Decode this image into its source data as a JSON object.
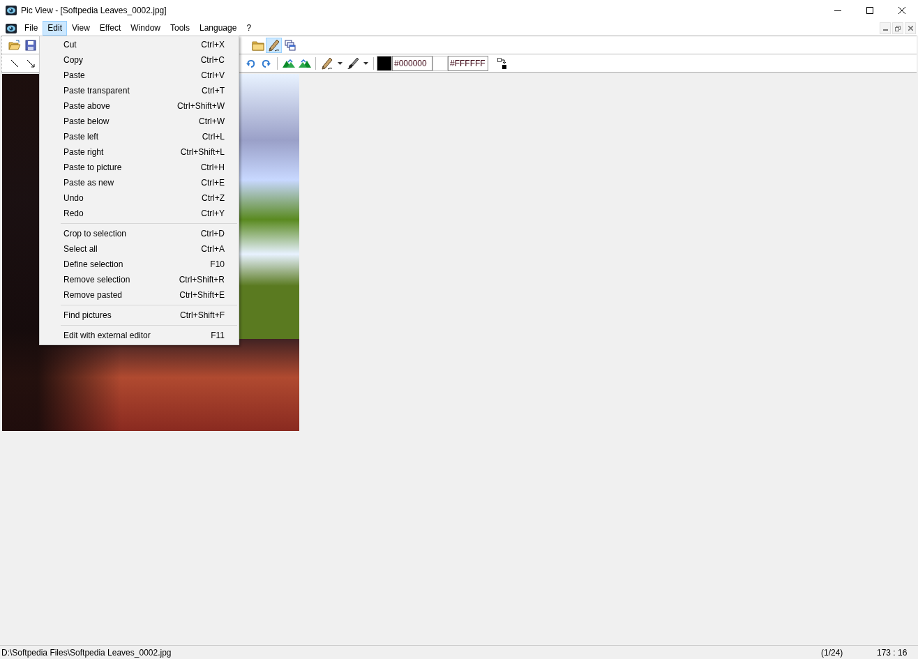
{
  "window": {
    "title": "Pic View - [Softpedia Leaves_0002.jpg]"
  },
  "menubar": [
    {
      "label": "File",
      "selected": false
    },
    {
      "label": "Edit",
      "selected": true
    },
    {
      "label": "View",
      "selected": false
    },
    {
      "label": "Effect",
      "selected": false
    },
    {
      "label": "Window",
      "selected": false
    },
    {
      "label": "Tools",
      "selected": false
    },
    {
      "label": "Language",
      "selected": false
    },
    {
      "label": "?",
      "selected": false
    }
  ],
  "toolbar": {
    "draw_pressed": true
  },
  "colors": [
    {
      "value": "#000000",
      "color": "#000000"
    },
    {
      "value": "#FFFFFF",
      "color": "#ffffff"
    }
  ],
  "edit_menu": {
    "groups": [
      {
        "items": [
          {
            "label": "Cut",
            "shortcut": "Ctrl+X"
          },
          {
            "label": "Copy",
            "shortcut": "Ctrl+C"
          },
          {
            "label": "Paste",
            "shortcut": "Ctrl+V"
          },
          {
            "label": "Paste transparent",
            "shortcut": "Ctrl+T"
          },
          {
            "label": "Paste above",
            "shortcut": "Ctrl+Shift+W"
          },
          {
            "label": "Paste below",
            "shortcut": "Ctrl+W"
          },
          {
            "label": "Paste left",
            "shortcut": "Ctrl+L"
          },
          {
            "label": "Paste right",
            "shortcut": "Ctrl+Shift+L"
          },
          {
            "label": "Paste to picture",
            "shortcut": "Ctrl+H"
          },
          {
            "label": "Paste as new",
            "shortcut": "Ctrl+E"
          },
          {
            "label": "Undo",
            "shortcut": "Ctrl+Z"
          },
          {
            "label": "Redo",
            "shortcut": "Ctrl+Y"
          }
        ]
      },
      {
        "items": [
          {
            "label": "Crop to selection",
            "shortcut": "Ctrl+D"
          },
          {
            "label": "Select all",
            "shortcut": "Ctrl+A"
          },
          {
            "label": "Define selection",
            "shortcut": "F10"
          },
          {
            "label": "Remove selection",
            "shortcut": "Ctrl+Shift+R"
          },
          {
            "label": "Remove pasted",
            "shortcut": "Ctrl+Shift+E"
          }
        ]
      },
      {
        "items": [
          {
            "label": "Find pictures",
            "shortcut": "Ctrl+Shift+F"
          }
        ]
      },
      {
        "items": [
          {
            "label": "Edit with external editor",
            "shortcut": "F11"
          }
        ]
      }
    ]
  },
  "status_bar": {
    "path": "D:\\Softpedia Files\\Softpedia Leaves_0002.jpg",
    "index": "(1/24)",
    "position": "173 : 16"
  }
}
